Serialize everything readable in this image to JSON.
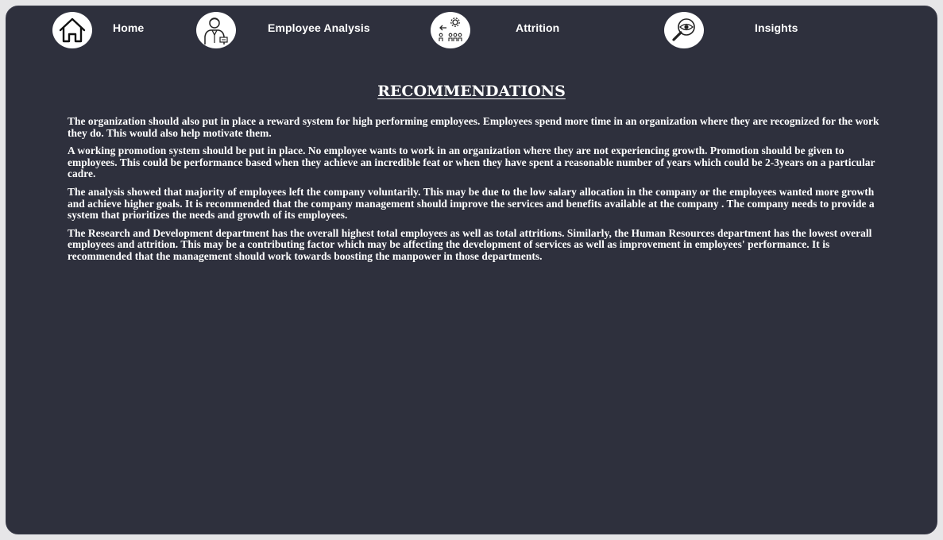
{
  "nav": {
    "items": [
      {
        "label": "Home",
        "icon": "home-icon"
      },
      {
        "label": "Employee Analysis",
        "icon": "employee-icon"
      },
      {
        "label": "Attrition",
        "icon": "attrition-icon"
      },
      {
        "label": "Insights",
        "icon": "insights-icon"
      }
    ]
  },
  "main": {
    "title": "RECOMMENDATIONS",
    "paragraphs": [
      "The organization should also put in place a reward system for high performing employees. Employees spend more time in an organization where they are recognized for the work they do. This would also help motivate them.",
      "A working promotion system should be put in place. No employee wants to work in an organization where they are not experiencing growth. Promotion should be given to employees. This could be performance based when they achieve an incredible feat or when they have spent a reasonable number of years which could be 2-3years on a particular cadre.",
      "The analysis showed that majority of employees left the company voluntarily. This may be due to the low salary allocation in the company or the employees wanted more growth and achieve higher goals. It is recommended that the company management should improve the services and benefits available at the company . The company needs to provide a system that prioritizes the needs and growth of its employees.",
      "The Research and Development department has the overall highest total employees as well as total attritions.  Similarly, the Human Resources department has the lowest  overall employees and attrition. This may be a contributing factor which may be affecting the development of services as well as improvement in employees' performance. It is recommended that the management should work towards boosting the manpower in those departments."
    ]
  },
  "colors": {
    "background": "#2e303d",
    "page": "#e6e6e8",
    "text": "#ffffff"
  }
}
